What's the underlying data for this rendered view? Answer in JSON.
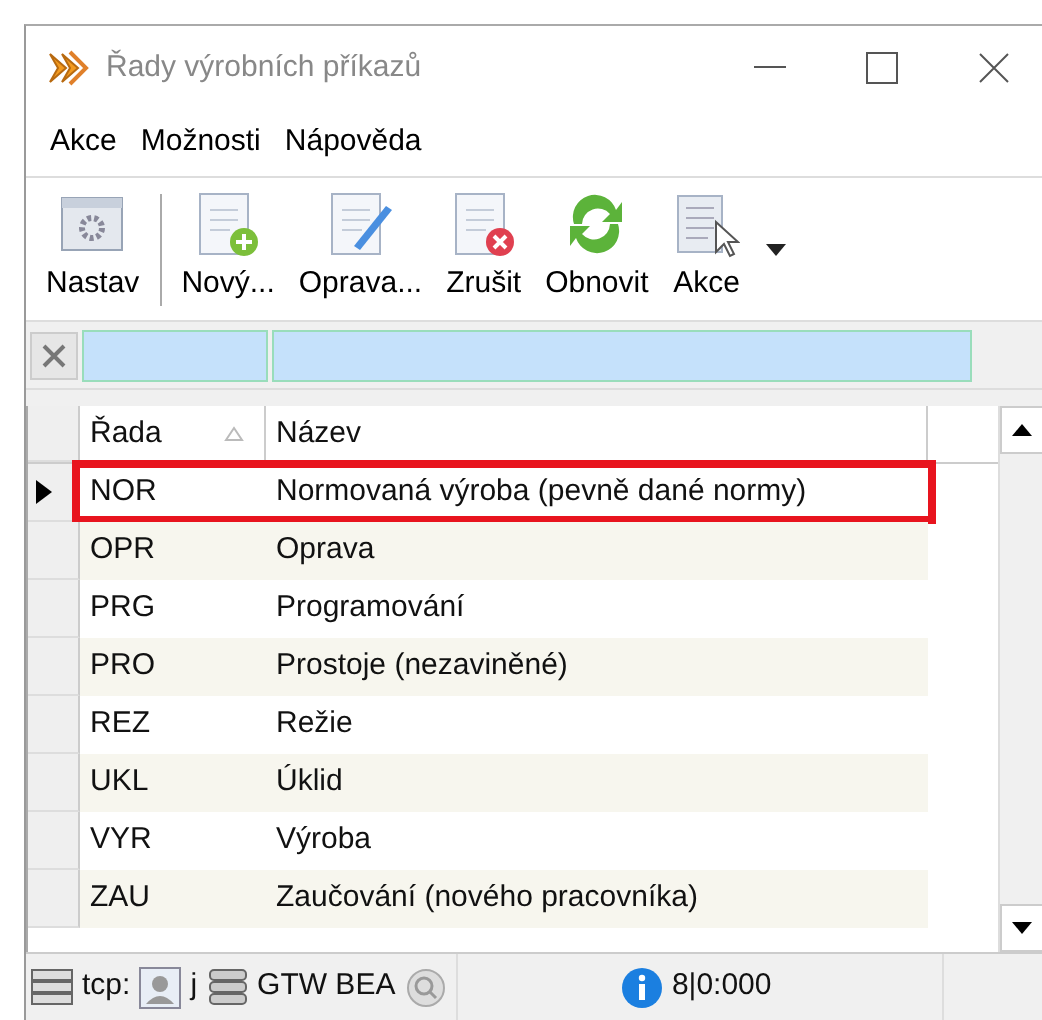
{
  "window": {
    "title": "Řady výrobních příkazů"
  },
  "menu": [
    "Akce",
    "Možnosti",
    "Nápověda"
  ],
  "toolbar": [
    {
      "kind": "settings",
      "label": "Nastav"
    },
    {
      "kind": "new",
      "label": "Nový..."
    },
    {
      "kind": "edit",
      "label": "Oprava..."
    },
    {
      "kind": "delete",
      "label": "Zrušit"
    },
    {
      "kind": "refresh",
      "label": "Obnovit"
    },
    {
      "kind": "actions",
      "label": "Akce"
    }
  ],
  "table": {
    "columns": [
      {
        "label": "Řada",
        "sorted": true
      },
      {
        "label": "Název",
        "sorted": false
      }
    ],
    "rows": [
      {
        "code": "NOR",
        "name": "Normovaná výroba (pevně dané normy)",
        "selected": true
      },
      {
        "code": "OPR",
        "name": "Oprava",
        "selected": false
      },
      {
        "code": "PRG",
        "name": "Programování",
        "selected": false
      },
      {
        "code": "PRO",
        "name": "Prostoje (nezaviněné)",
        "selected": false
      },
      {
        "code": "REZ",
        "name": "Režie",
        "selected": false
      },
      {
        "code": "UKL",
        "name": "Úklid",
        "selected": false
      },
      {
        "code": "VYR",
        "name": "Výroba",
        "selected": false
      },
      {
        "code": "ZAU",
        "name": "Zaučování (nového pracovníka)",
        "selected": false
      }
    ]
  },
  "status_bar": {
    "connection": "tcp:",
    "user": "j",
    "database": "GTW BEA",
    "counter": "8|0:000"
  }
}
